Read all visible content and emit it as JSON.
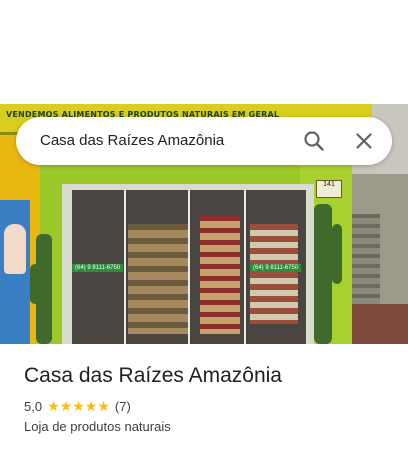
{
  "search": {
    "query": "Casa das Raízes Amazônia"
  },
  "photo": {
    "sign_text": "VENDEMOS ALIMENTOS E PRODUTOS NATURAIS EM GERAL",
    "phone_left": "(64) 9 8111-6750",
    "phone_right": "(64) 9 8111-6750",
    "street_number": "141"
  },
  "place": {
    "title": "Casa das Raízes Amazônia",
    "rating": "5,0",
    "stars": 5,
    "review_count": "(7)",
    "category": "Loja de produtos naturais"
  },
  "colors": {
    "star": "#fbbc04",
    "text_primary": "#202124",
    "text_secondary": "#3c4043"
  }
}
